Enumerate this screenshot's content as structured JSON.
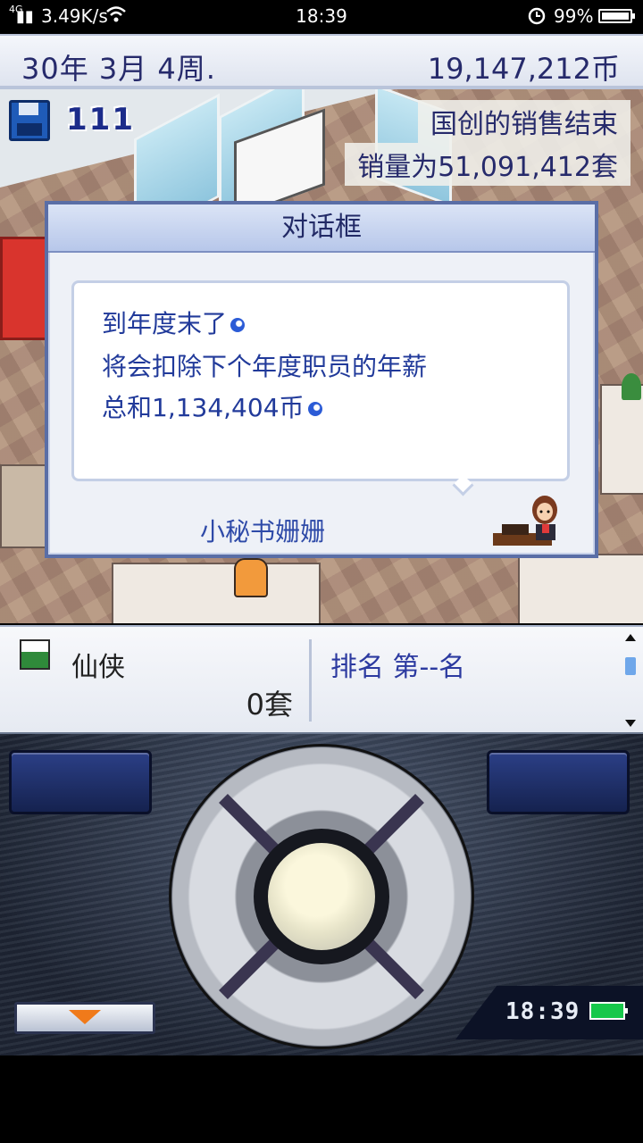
{
  "status_bar": {
    "signal": "4G",
    "net_speed": "3.49K/s",
    "time": "18:39",
    "battery_pct": "99%"
  },
  "top_bar": {
    "date": "30年 3月 4周.",
    "money": "19,147,212币"
  },
  "scene": {
    "counter": "111",
    "notice_line1": "国创的销售结束",
    "notice_line2": "销量为51,091,412套"
  },
  "dialog": {
    "title": "对话框",
    "lines": [
      "到年度末了",
      "将会扣除下个年度职员的年薪",
      "总和1,134,404币"
    ],
    "speaker": "小秘书姗姗"
  },
  "info_panel": {
    "game_name": "仙侠",
    "sales": "0套",
    "rank": "排名 第--名",
    "scroll_position": 0.2
  },
  "controller": {
    "clock": "18:39",
    "battery_color": "#17c84a"
  }
}
